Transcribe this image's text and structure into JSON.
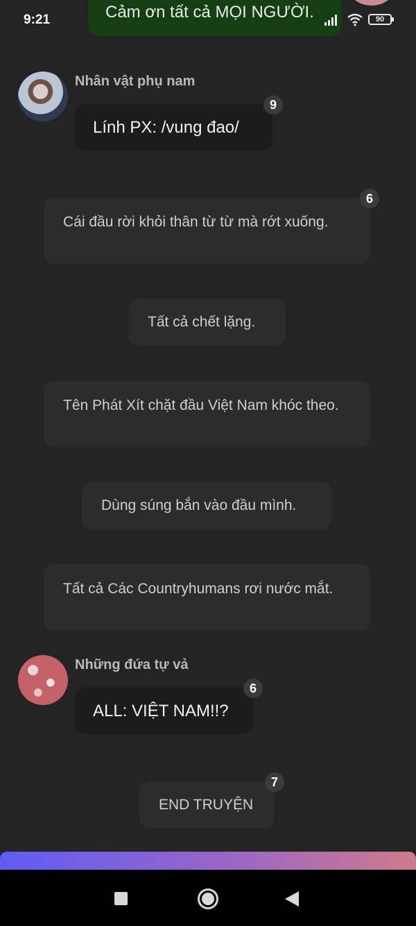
{
  "status_bar": {
    "time": "9:21",
    "battery": "90",
    "icons": [
      "signal-icon",
      "wifi-icon",
      "battery-icon"
    ]
  },
  "top_message": {
    "text": "Cảm ơn tất cả MỌI NGƯỜI."
  },
  "messages": [
    {
      "type": "character",
      "speaker": "Nhân vật phụ nam",
      "text": "Lính PX: /vung đao/",
      "badge": "9"
    },
    {
      "type": "narration",
      "text": "Cái đầu rời khỏi thân từ từ mà rớt xuống.",
      "badge": "6"
    },
    {
      "type": "narration",
      "text": "Tất cả chết lặng."
    },
    {
      "type": "narration",
      "text": "Tên Phát Xít chặt đầu Việt Nam khóc theo."
    },
    {
      "type": "narration",
      "text": "Dùng súng bắn vào đầu mình."
    },
    {
      "type": "narration",
      "text": "Tất cả Các Countryhumans rơi nước mắt."
    },
    {
      "type": "character",
      "speaker": "Những đứa tự vả",
      "text": "ALL: VIỆT NAM!!?",
      "badge": "6"
    },
    {
      "type": "narration",
      "text": "END TRUYỆN",
      "badge": "7"
    }
  ],
  "colors": {
    "background": "#242424",
    "top_bubble": "#153f12",
    "gradient_start": "#5f5cf4",
    "gradient_end": "#cf7a8c"
  },
  "nav": {
    "icons": [
      "recent-apps-icon",
      "home-icon",
      "back-icon"
    ]
  }
}
